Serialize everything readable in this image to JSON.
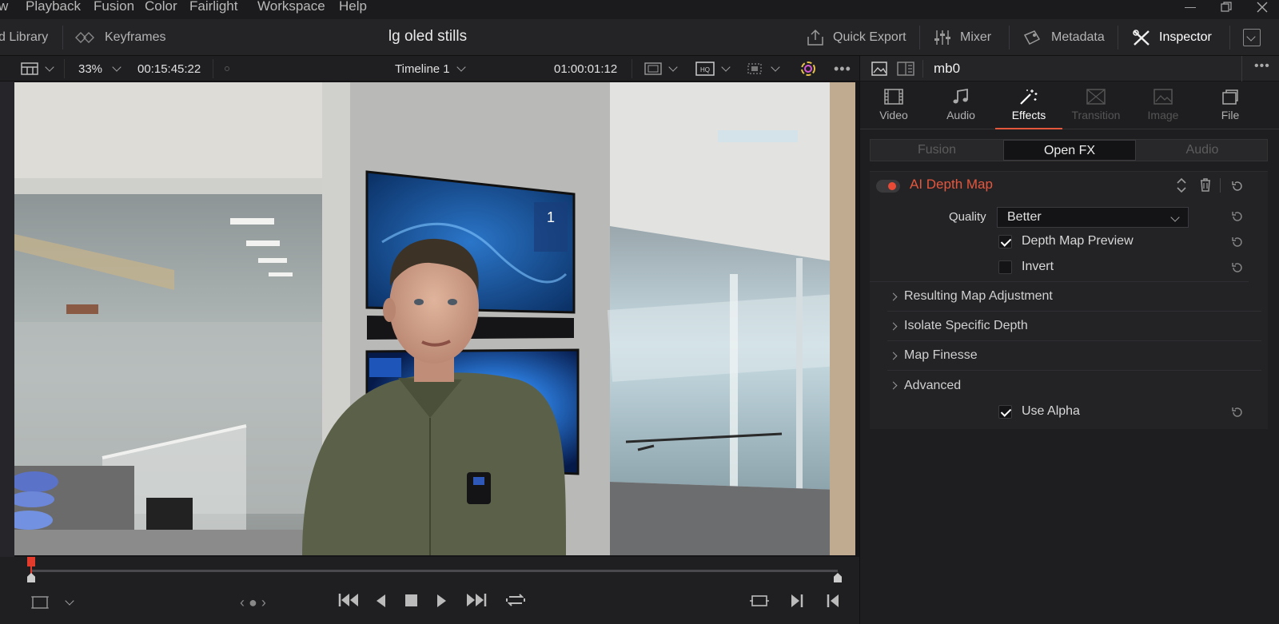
{
  "menu": [
    "w",
    "Playback",
    "Fusion",
    "Color",
    "Fairlight",
    "Workspace",
    "Help"
  ],
  "toolbar": {
    "media_library": "d Library",
    "keyframes": "Keyframes",
    "project_title": "lg oled stills",
    "quick_export": "Quick Export",
    "mixer": "Mixer",
    "metadata": "Metadata",
    "inspector": "Inspector"
  },
  "viewer": {
    "zoom": "33%",
    "source_timecode": "00:15:45:22",
    "timeline_name": "Timeline 1",
    "record_timecode": "01:00:01:12"
  },
  "inspector": {
    "clip_name": "mb0",
    "tabs": [
      {
        "label": "Video",
        "icon": "film-icon",
        "enabled": true
      },
      {
        "label": "Audio",
        "icon": "music-note-icon",
        "enabled": true
      },
      {
        "label": "Effects",
        "icon": "magic-wand-icon",
        "enabled": true,
        "active": true
      },
      {
        "label": "Transition",
        "icon": "transition-icon",
        "enabled": false
      },
      {
        "label": "Image",
        "icon": "image-icon",
        "enabled": false
      },
      {
        "label": "File",
        "icon": "file-stack-icon",
        "enabled": true
      }
    ],
    "subtabs": [
      {
        "label": "Fusion",
        "active": false
      },
      {
        "label": "Open FX",
        "active": true
      },
      {
        "label": "Audio",
        "active": false
      }
    ],
    "effect": {
      "name": "AI Depth Map",
      "enabled": true,
      "quality_label": "Quality",
      "quality_value": "Better",
      "depth_map_preview_label": "Depth Map Preview",
      "depth_map_preview": true,
      "invert_label": "Invert",
      "invert": false,
      "sections": [
        "Resulting Map Adjustment",
        "Isolate Specific Depth",
        "Map Finesse",
        "Advanced"
      ],
      "use_alpha_label": "Use Alpha",
      "use_alpha": true
    }
  },
  "colors": {
    "accent": "#e4573d",
    "background": "#1a1a1c",
    "panel": "#232326"
  }
}
